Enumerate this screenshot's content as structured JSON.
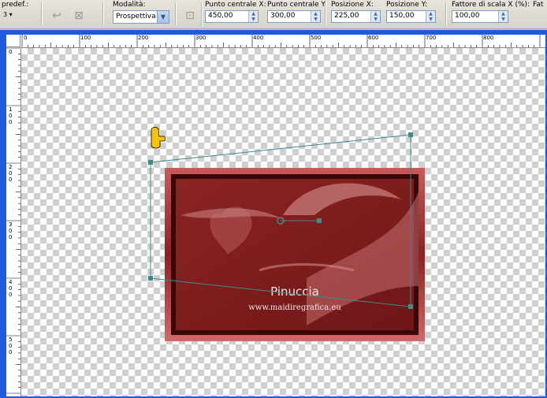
{
  "toolbar": {
    "presets_label": "predef.:",
    "mode_label": "Modalità:",
    "mode_value": "Prospettiva",
    "cx_label": "Punto centrale X:",
    "cx_value": "450,00",
    "cy_label": "Punto centrale Y:",
    "cy_value": "300,00",
    "px_label": "Posizione X:",
    "px_value": "225,00",
    "py_label": "Posizione Y:",
    "py_value": "150,00",
    "sx_label": "Fattore di scala X (%):",
    "sx_value": "100,00",
    "cut_label": "Fat"
  },
  "ruler": {
    "h_ticks": [
      "0",
      "100",
      "200",
      "300",
      "400",
      "500",
      "600",
      "700",
      "800"
    ],
    "v_ticks": [
      "0",
      "1 0 0",
      "2 0 0",
      "3 0 0",
      "4 0 0",
      "5 0 0"
    ]
  },
  "watermark": {
    "name": "Pinuccia",
    "url": "www.maidiregrafica.eu"
  },
  "colors": {
    "frame": "#8a2222",
    "window_border": "#1e5adc",
    "handle": "#3a8c8c"
  }
}
